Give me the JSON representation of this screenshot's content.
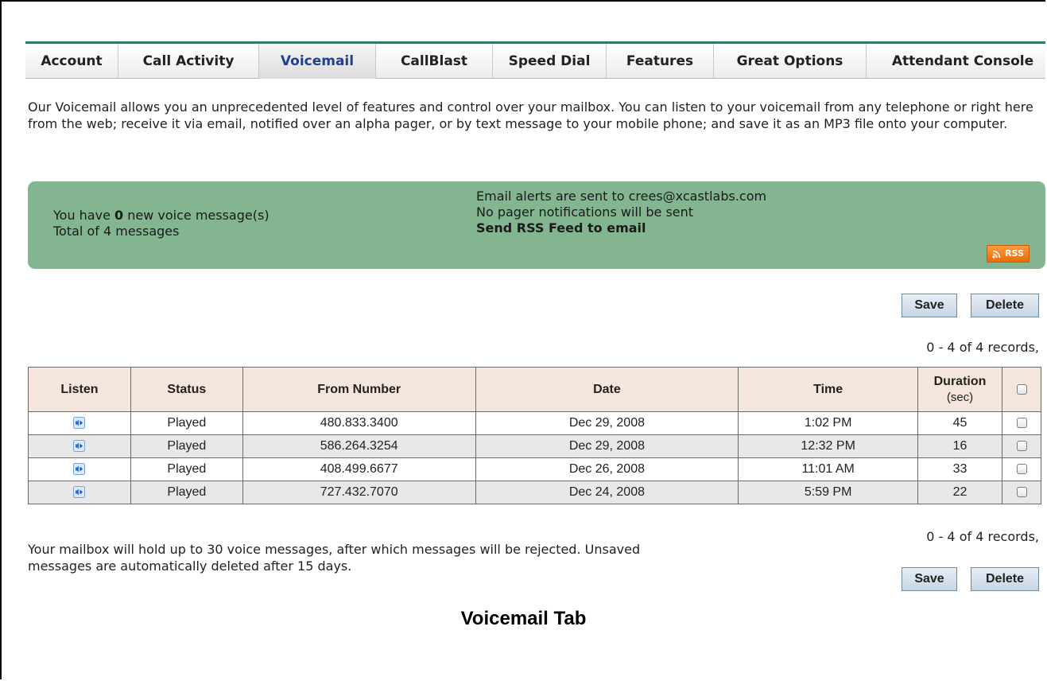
{
  "tabs": [
    {
      "label": "Account",
      "active": false
    },
    {
      "label": "Call Activity",
      "active": false
    },
    {
      "label": "Voicemail",
      "active": true
    },
    {
      "label": "CallBlast",
      "active": false
    },
    {
      "label": "Speed Dial",
      "active": false
    },
    {
      "label": "Features",
      "active": false
    },
    {
      "label": "Great Options",
      "active": false
    },
    {
      "label": "Attendant Console",
      "active": false
    }
  ],
  "intro": "Our Voicemail allows you an unprecedented level of features and control over your mailbox. You can listen to your voicemail from any telephone or right here from the web; receive it via email, notified over an alpha pager, or by text message to your mobile phone; and save it as an MP3 file onto your computer.",
  "summary": {
    "new_prefix": "You have ",
    "new_count": "0",
    "new_suffix": " new voice message(s)",
    "total": "Total of 4 messages",
    "email_alert": "Email alerts are sent to crees@xcastlabs.com",
    "pager": "No pager notifications will be sent",
    "rss_link": "Send RSS Feed to email",
    "rss_badge": "RSS",
    "colors": {
      "panel": "#84b591",
      "rss": "#f07d1a"
    }
  },
  "actions": {
    "save": "Save",
    "delete": "Delete"
  },
  "records_label": "0 - 4 of 4 records,",
  "table": {
    "headers": {
      "listen": "Listen",
      "status": "Status",
      "from": "From Number",
      "date": "Date",
      "time": "Time",
      "duration": "Duration",
      "duration_unit": "(sec)"
    },
    "rows": [
      {
        "status": "Played",
        "from": "480.833.3400",
        "date": "Dec 29, 2008",
        "time": "1:02 PM",
        "duration": "45",
        "checked": false
      },
      {
        "status": "Played",
        "from": "586.264.3254",
        "date": "Dec 29, 2008",
        "time": "12:32 PM",
        "duration": "16",
        "checked": false
      },
      {
        "status": "Played",
        "from": "408.499.6677",
        "date": "Dec 26, 2008",
        "time": "11:01 AM",
        "duration": "33",
        "checked": false
      },
      {
        "status": "Played",
        "from": "727.432.7070",
        "date": "Dec 24, 2008",
        "time": "5:59 PM",
        "duration": "22",
        "checked": false
      }
    ]
  },
  "note": "Your mailbox will hold up to 30 voice messages, after which messages will be rejected. Unsaved messages are automatically deleted after 15 days.",
  "caption": "Voicemail Tab"
}
